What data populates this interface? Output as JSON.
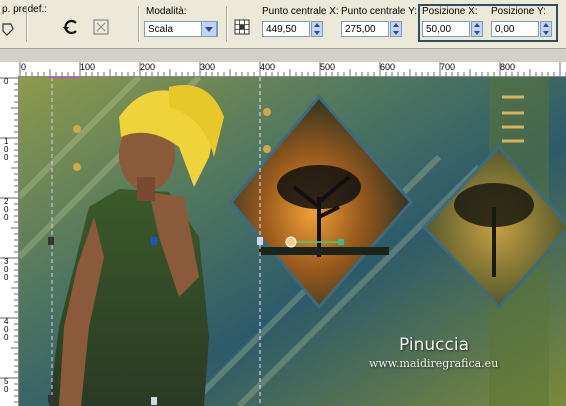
{
  "toolbar": {
    "preset_label": "p. predef.:",
    "mode": {
      "label": "Modalità:",
      "value": "Scala"
    },
    "center_x": {
      "label": "Punto centrale X:",
      "value": "449,50"
    },
    "center_y": {
      "label": "Punto centrale Y:",
      "value": "275,00"
    },
    "pos_x": {
      "label": "Posizione X:",
      "value": "50,00"
    },
    "pos_y": {
      "label": "Posizione Y:",
      "value": "0,00"
    }
  },
  "ruler_top": {
    "labels": [
      "0",
      "100",
      "200",
      "300",
      "400",
      "500",
      "600",
      "700",
      "800"
    ]
  },
  "ruler_left": {
    "labels": [
      "0",
      "1\n0\n0",
      "2\n0\n0",
      "3\n0\n0",
      "4\n0\n0",
      "5\n0"
    ]
  },
  "canvas": {
    "watermark_name": "Pinuccia",
    "watermark_site": "www.maidiregrafica.eu"
  },
  "icons": {
    "preset": "preset-icon",
    "reset": "reset-icon",
    "apply": "apply-icon",
    "center_tool": "center-grid-icon"
  }
}
